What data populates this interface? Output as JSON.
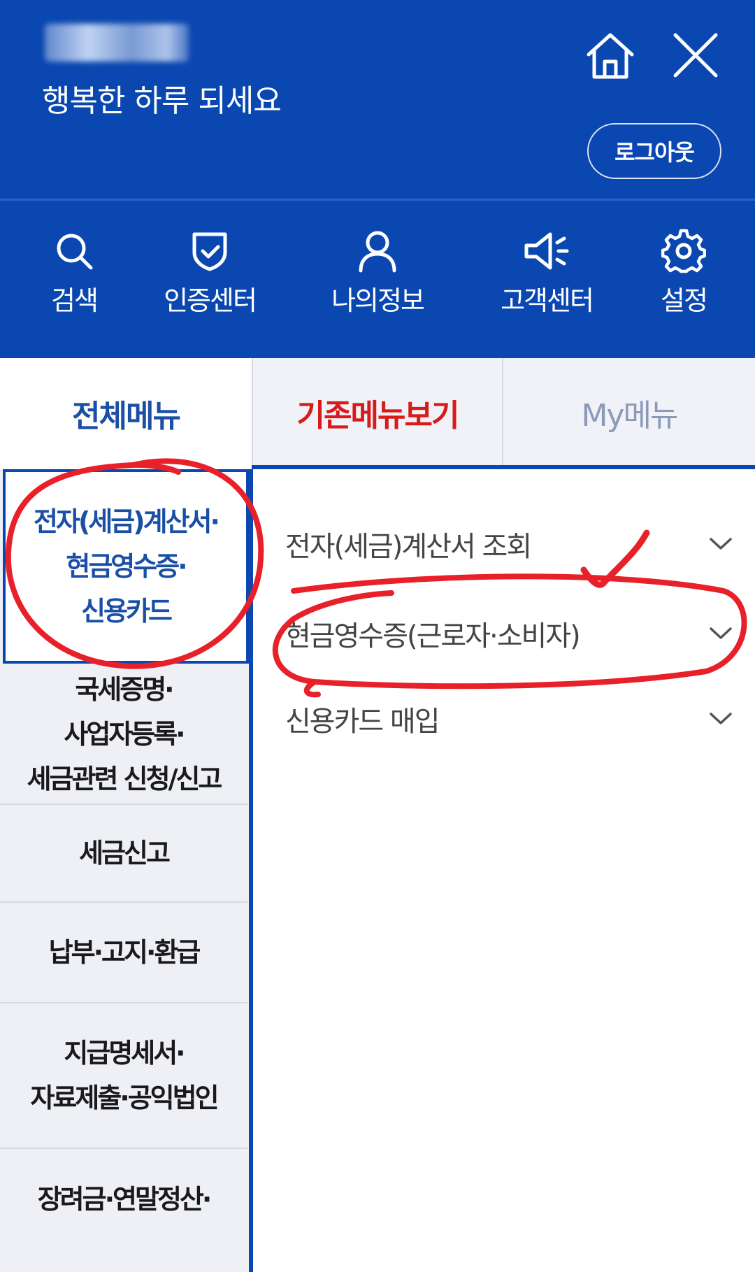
{
  "header": {
    "greeting": "행복한 하루 되세요",
    "logout_label": "로그아웃",
    "home_icon": "home-icon",
    "close_icon": "close-icon",
    "background_color": "#0a47b0"
  },
  "quick_menu": [
    {
      "label": "검색",
      "icon": "search-icon"
    },
    {
      "label": "인증센터",
      "icon": "shield-check-icon"
    },
    {
      "label": "나의정보",
      "icon": "user-icon"
    },
    {
      "label": "고객센터",
      "icon": "megaphone-icon"
    },
    {
      "label": "설정",
      "icon": "gear-icon"
    }
  ],
  "tabs": [
    {
      "label": "전체메뉴",
      "selected": true
    },
    {
      "label": "기존메뉴보기",
      "selected": false,
      "color": "#d91a1a"
    },
    {
      "label": "My메뉴",
      "selected": false
    }
  ],
  "categories": [
    {
      "label": "전자(세금)계산서·\n현금영수증·\n신용카드",
      "selected": true
    },
    {
      "label": "국세증명·\n사업자등록·\n세금관련 신청/신고"
    },
    {
      "label": "세금신고"
    },
    {
      "label": "납부·고지·환급"
    },
    {
      "label": "지급명세서·\n자료제출·공익법인"
    },
    {
      "label": "장려금·연말정산·"
    }
  ],
  "submenu": [
    {
      "label": "전자(세금)계산서 조회",
      "icon": "chevron-down-icon"
    },
    {
      "label": "현금영수증(근로자·소비자)",
      "icon": "chevron-down-icon"
    },
    {
      "label": "신용카드 매입",
      "icon": "chevron-down-icon"
    }
  ],
  "annotation_color": "#e8202a"
}
